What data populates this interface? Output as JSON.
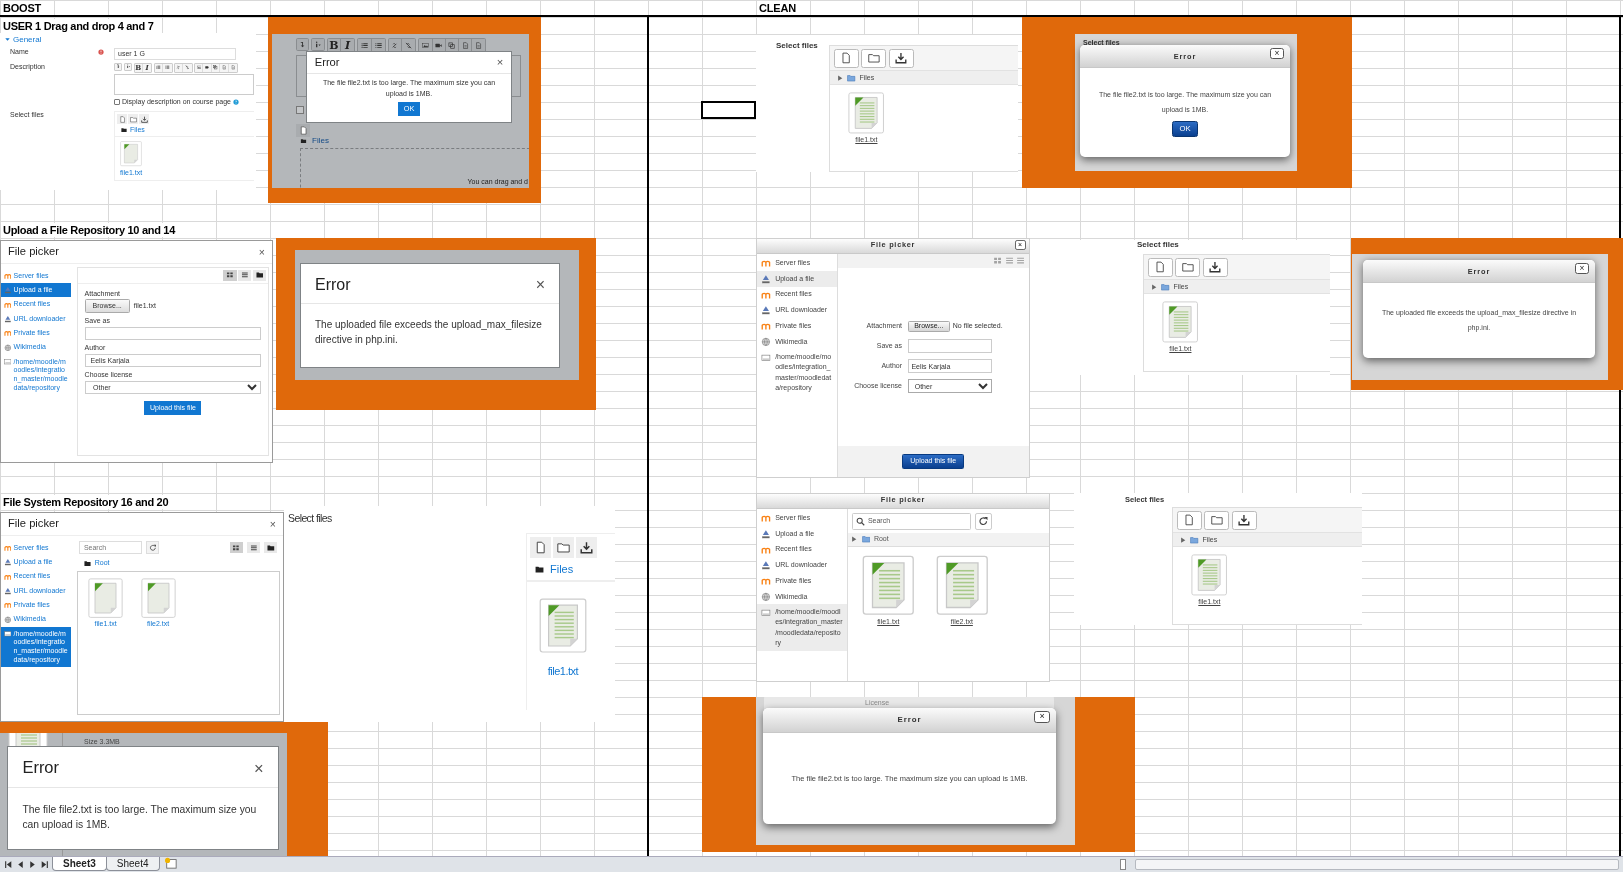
{
  "sheet": {
    "column_headings": [
      "BOOST",
      "CLEAN"
    ],
    "section_titles": [
      "USER 1 Drag and drop 4 and 7",
      "Upload a File Repository 10 and 14",
      "File System Repository 16 and 20"
    ]
  },
  "boost": [
    {
      "kind": "course_form",
      "legend": "General",
      "name_label": "Name",
      "required": true,
      "name_value": "user 1 G",
      "description_label": "Description",
      "toolbar_labels": [
        "B",
        "I"
      ],
      "checkbox_label": "Display description on course page",
      "checked": false,
      "files_label": "Select files",
      "folder": "Files",
      "files": [
        "file1.txt"
      ]
    },
    {
      "kind": "boost_error",
      "toolbar_labels": [
        "B",
        "I"
      ],
      "checked": false,
      "background_texts": [
        "Files",
        "You can drag and d"
      ],
      "title": "Error",
      "close": "×",
      "message": "The file file2.txt is too large. The maximum size you can upload is 1MB.",
      "button": "OK"
    },
    {
      "kind": "boost_upload_picker",
      "title": "File picker",
      "close": "×",
      "repositories": [
        {
          "label": "Server files",
          "selected": false
        },
        {
          "label": "Upload a file",
          "selected": true
        },
        {
          "label": "Recent files",
          "selected": false
        },
        {
          "label": "URL downloader",
          "selected": false
        },
        {
          "label": "Private files",
          "selected": false
        },
        {
          "label": "Wikimedia",
          "selected": false
        },
        {
          "label": "/home/moodle/moodles/integration_master/moodledata/repository",
          "selected": false
        }
      ],
      "attachment_label": "Attachment",
      "browse_button": "Browse...",
      "file_status": "file1.txt",
      "save_as_label": "Save as",
      "author_label": "Author",
      "author_value": "Eelis Karjala",
      "license_label": "Choose license",
      "license_value": "Other",
      "submit": "Upload this file"
    },
    {
      "kind": "boost_error",
      "title": "Error",
      "close": "×",
      "message": "The uploaded file exceeds the upload_max_filesize directive in php.ini."
    },
    {
      "kind": "boost_browse_picker",
      "title": "File picker",
      "close": "×",
      "repositories": [
        {
          "label": "Server files",
          "selected": false
        },
        {
          "label": "Upload a file",
          "selected": false
        },
        {
          "label": "Recent files",
          "selected": false
        },
        {
          "label": "URL downloader",
          "selected": false
        },
        {
          "label": "Private files",
          "selected": false
        },
        {
          "label": "Wikimedia",
          "selected": false
        },
        {
          "label": "/home/moodle/moodles/integration_master/moodledata/repository",
          "selected": true
        }
      ],
      "search_placeholder": "Search",
      "path": "Root",
      "files": [
        "file1.txt",
        "file2.txt"
      ]
    },
    {
      "kind": "boost_select_files",
      "label": "Select files",
      "folder": "Files",
      "files": [
        "file1.txt"
      ]
    },
    {
      "kind": "boost_error",
      "background_texts": [
        "Size 3.3MB"
      ],
      "title": "Error",
      "close": "×",
      "message": "The file file2.txt is too large. The maximum size you can upload is 1MB."
    }
  ],
  "clean": [
    {
      "kind": "clean_select_files",
      "label": "Select files",
      "folder": "Files",
      "files": [
        "file1.txt"
      ]
    },
    {
      "kind": "clean_error",
      "background_texts": [
        "Select files"
      ],
      "title": "Error",
      "close": "×",
      "message": "The file file2.txt is too large. The maximum size you can upload is 1MB.",
      "button": "OK"
    },
    {
      "kind": "clean_upload_picker",
      "title": "File picker",
      "close": "×",
      "repositories": [
        {
          "label": "Server files",
          "selected": false
        },
        {
          "label": "Upload a file",
          "selected": true
        },
        {
          "label": "Recent files",
          "selected": false
        },
        {
          "label": "URL downloader",
          "selected": false
        },
        {
          "label": "Private files",
          "selected": false
        },
        {
          "label": "Wikimedia",
          "selected": false
        },
        {
          "label": "/home/moodle/moodles/integration_master/moodledata/repository",
          "selected": false
        }
      ],
      "attachment_label": "Attachment",
      "browse_button": "Browse...",
      "file_status": "No file selected.",
      "save_as_label": "Save as",
      "author_label": "Author",
      "author_value": "Eelis Karjala",
      "license_label": "Choose license",
      "license_value": "Other",
      "submit": "Upload this file"
    },
    {
      "kind": "clean_select_files",
      "label": "Select files",
      "folder": "Files",
      "files": [
        "file1.txt"
      ]
    },
    {
      "kind": "clean_error",
      "title": "Error",
      "close": "×",
      "message": "The uploaded file exceeds the upload_max_filesize directive in php.ini."
    },
    {
      "kind": "clean_browse_picker",
      "title": "File picker",
      "repositories": [
        {
          "label": "Server files",
          "selected": false
        },
        {
          "label": "Upload a file",
          "selected": false
        },
        {
          "label": "Recent files",
          "selected": false
        },
        {
          "label": "URL downloader",
          "selected": false
        },
        {
          "label": "Private files",
          "selected": false
        },
        {
          "label": "Wikimedia",
          "selected": false
        },
        {
          "label": "/home/moodle/moodles/integration_master/moodledata/repository",
          "selected": true
        }
      ],
      "search_placeholder": "Search",
      "path": "Root",
      "files": [
        "file1.txt",
        "file2.txt"
      ]
    },
    {
      "kind": "clean_select_files",
      "label": "Select files",
      "folder": "Files",
      "files": [
        "file1.txt"
      ]
    },
    {
      "kind": "clean_error",
      "background_texts": [
        "License"
      ],
      "title": "Error",
      "close": "×",
      "message": "The file file2.txt is too large. The maximum size you can upload is 1MB."
    }
  ],
  "sheet_tabs": [
    {
      "label": "Sheet3",
      "selected": true
    },
    {
      "label": "Sheet4",
      "selected": false
    }
  ]
}
